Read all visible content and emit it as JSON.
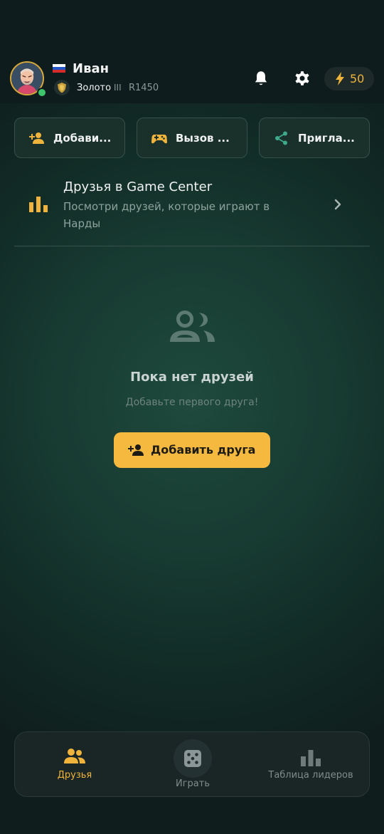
{
  "header": {
    "username": "Иван",
    "country_flag": "flag-russia",
    "rank_name": "Золото",
    "rank_level": "III",
    "rating": "R1450",
    "energy": "50",
    "online_color": "#3ec46b",
    "accent_color": "#f0b43c"
  },
  "actions": [
    {
      "label": "Добави...",
      "icon": "add-person-icon"
    },
    {
      "label": "Вызов ...",
      "icon": "gamepad-icon"
    },
    {
      "label": "Пригла...",
      "icon": "share-icon"
    }
  ],
  "game_center": {
    "title": "Друзья в Game Center",
    "subtitle": "Посмотри друзей, которые играют в Нарды",
    "icon": "bar-chart-icon"
  },
  "empty_state": {
    "title": "Пока нет друзей",
    "subtitle": "Добавьте первого друга!",
    "button_label": "Добавить друга"
  },
  "bottom_nav": {
    "friends": "Друзья",
    "play": "Играть",
    "leaderboard": "Таблица лидеров",
    "active": "friends"
  }
}
